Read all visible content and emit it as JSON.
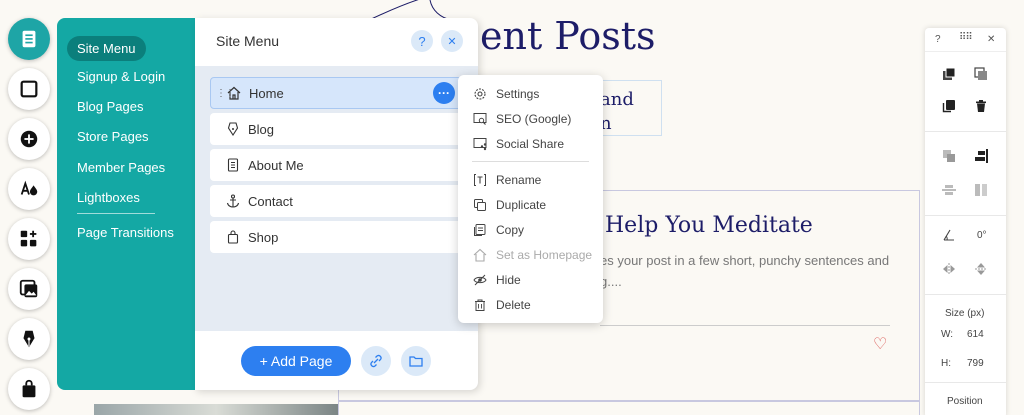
{
  "background": {
    "heading": "ent Posts",
    "box_text_line1": "and",
    "box_text_line2": "n",
    "card_title": "Help You Meditate",
    "card_text_line1": "es your post in a few short, punchy sentences and",
    "card_text_line2": "g...."
  },
  "teal_menu": {
    "items": [
      {
        "label": "Site Menu"
      },
      {
        "label": "Signup & Login"
      },
      {
        "label": "Blog Pages"
      },
      {
        "label": "Store Pages"
      },
      {
        "label": "Member Pages"
      },
      {
        "label": "Lightboxes"
      },
      {
        "label": "Page Transitions"
      }
    ]
  },
  "site_menu": {
    "title": "Site Menu",
    "help_symbol": "?",
    "close_symbol": "✕",
    "pages": [
      {
        "label": "Home",
        "icon": "home-icon"
      },
      {
        "label": "Blog",
        "icon": "pen-icon"
      },
      {
        "label": "About Me",
        "icon": "document-icon"
      },
      {
        "label": "Contact",
        "icon": "anchor-icon"
      },
      {
        "label": "Shop",
        "icon": "shopping-bag-icon"
      }
    ],
    "dots_symbol": "···",
    "add_page_label": "+ Add Page"
  },
  "context_menu": {
    "items": [
      {
        "label": "Settings",
        "icon": "gear-icon"
      },
      {
        "label": "SEO (Google)",
        "icon": "seo-icon"
      },
      {
        "label": "Social Share",
        "icon": "social-share-icon"
      },
      {
        "label": "Rename",
        "icon": "rename-icon"
      },
      {
        "label": "Duplicate",
        "icon": "duplicate-icon"
      },
      {
        "label": "Copy",
        "icon": "copy-icon"
      },
      {
        "label": "Set as Homepage",
        "icon": "home-icon",
        "disabled": true
      },
      {
        "label": "Hide",
        "icon": "eye-icon"
      },
      {
        "label": "Delete",
        "icon": "trash-icon"
      }
    ]
  },
  "inspector": {
    "help": "?",
    "close": "✕",
    "rotation": "0°",
    "size_title": "Size (px)",
    "width_label": "W:",
    "width_value": "614",
    "height_label": "H:",
    "height_value": "799",
    "position_title": "Position"
  },
  "colors": {
    "teal": "#14a8a4",
    "accent_blue": "#2d7ff0",
    "heading_navy": "#1d1d68"
  }
}
